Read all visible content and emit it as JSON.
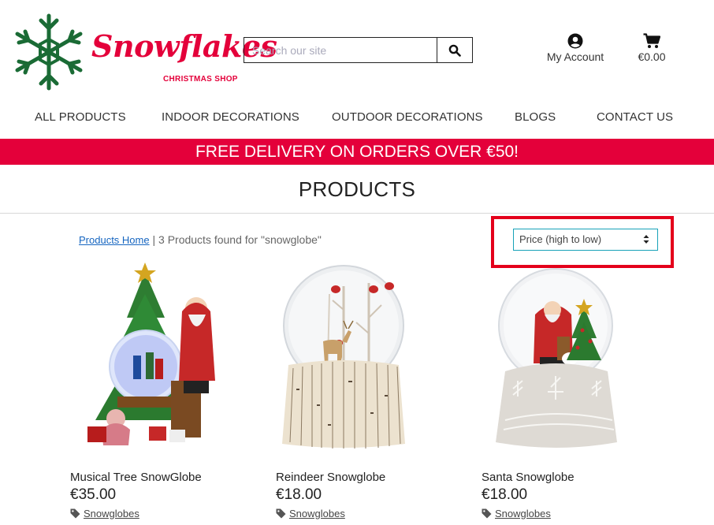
{
  "brand": {
    "name": "Snowflakes",
    "tagline": "CHRISTMAS SHOP",
    "color": "#e4003a"
  },
  "search": {
    "placeholder": "Search our site",
    "icon": "search-icon"
  },
  "account": {
    "label": "My Account",
    "icon": "user-circle-icon"
  },
  "cart": {
    "total": "€0.00",
    "icon": "shopping-cart-icon"
  },
  "nav": {
    "items": [
      {
        "label": "ALL PRODUCTS"
      },
      {
        "label": "INDOOR DECORATIONS"
      },
      {
        "label": "OUTDOOR DECORATIONS"
      },
      {
        "label": "BLOGS"
      },
      {
        "label": "CONTACT US"
      }
    ]
  },
  "banner": {
    "text": "FREE DELIVERY ON ORDERS OVER €50!",
    "color": "#e4003a"
  },
  "page": {
    "title": "PRODUCTS"
  },
  "breadcrumb": {
    "home_link": "Products Home",
    "separator": "|",
    "summary": "3 Products found for \"snowglobe\""
  },
  "sort": {
    "selected": "Price (high to low)"
  },
  "products": [
    {
      "name": "Musical Tree SnowGlobe",
      "price": "€35.00",
      "category": "Snowglobes"
    },
    {
      "name": "Reindeer Snowglobe",
      "price": "€18.00",
      "category": "Snowglobes"
    },
    {
      "name": "Santa Snowglobe",
      "price": "€18.00",
      "category": "Snowglobes"
    }
  ]
}
